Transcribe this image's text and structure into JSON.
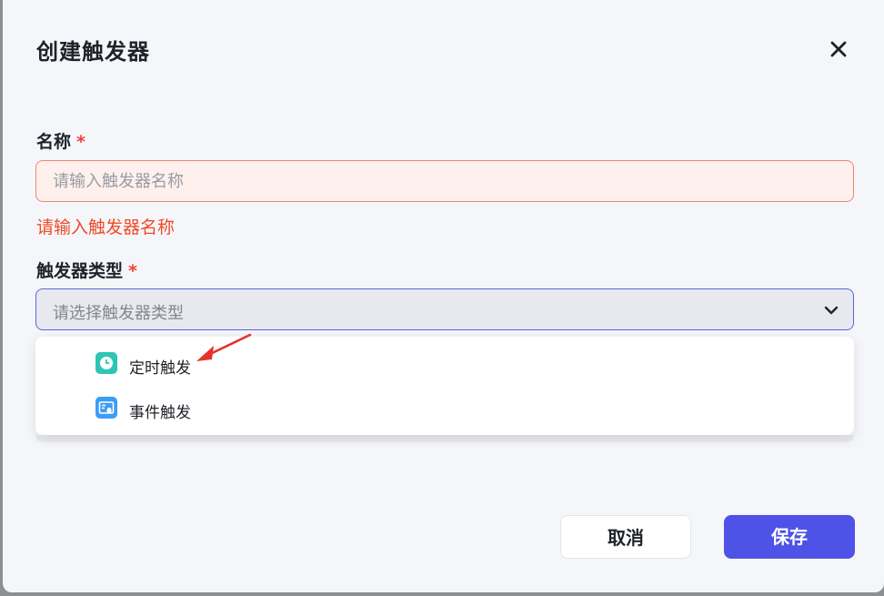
{
  "dialog": {
    "title": "创建触发器",
    "close_icon": "close-icon"
  },
  "name_field": {
    "label": "名称",
    "required_mark": "*",
    "placeholder": "请输入触发器名称",
    "value": "",
    "error": "请输入触发器名称"
  },
  "type_field": {
    "label": "触发器类型",
    "required_mark": "*",
    "placeholder": "请选择触发器类型",
    "options": [
      {
        "label": "定时触发",
        "icon": "clock-icon",
        "color": "#2ec4b6"
      },
      {
        "label": "事件触发",
        "icon": "event-icon",
        "color": "#3d9cf5"
      }
    ]
  },
  "footer": {
    "cancel_label": "取消",
    "save_label": "保存"
  },
  "colors": {
    "accent": "#4e52e6",
    "error": "#f04a26",
    "annotation_arrow": "#e8322b"
  }
}
